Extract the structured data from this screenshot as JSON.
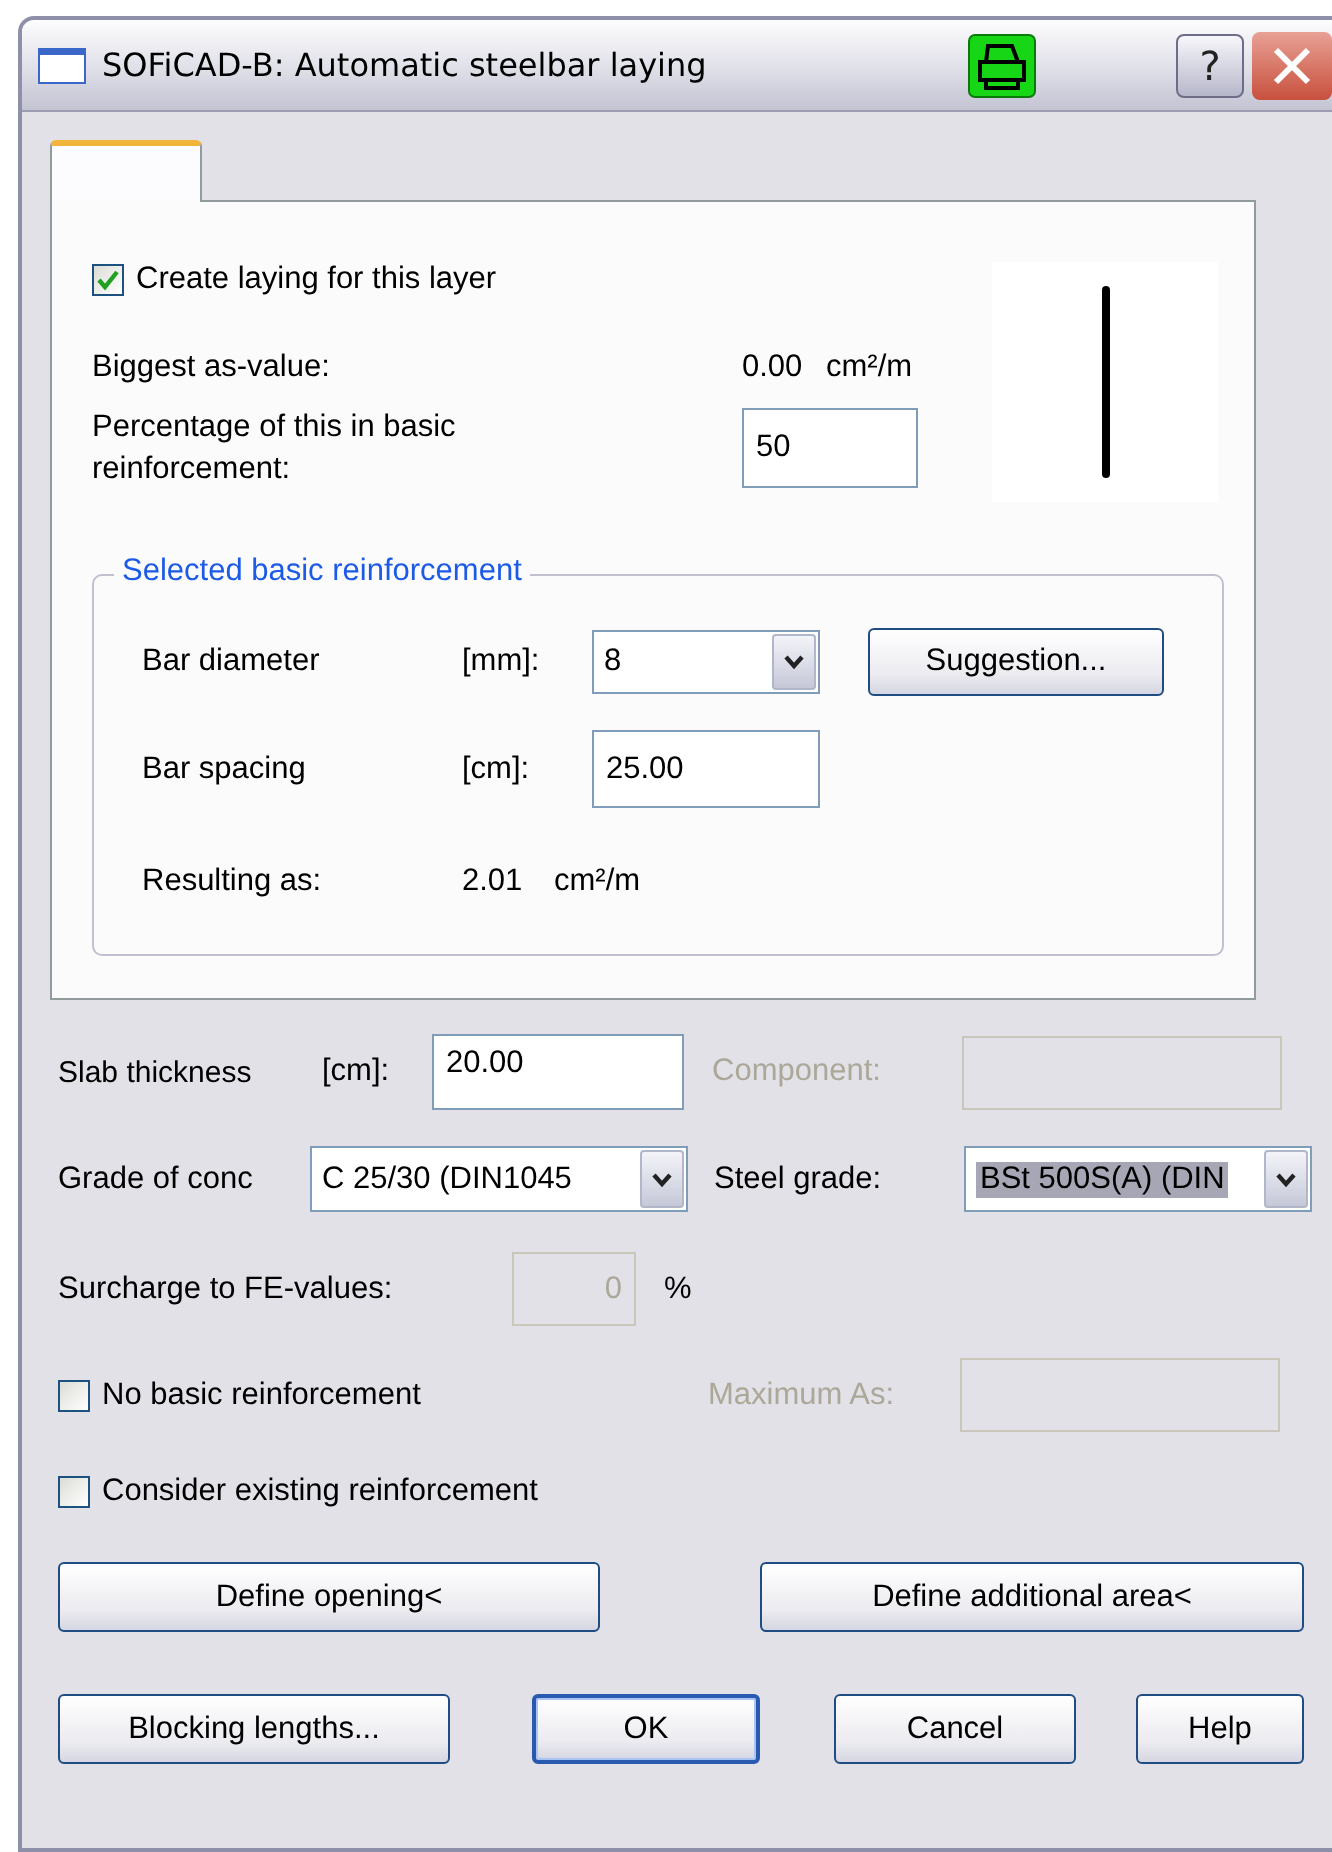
{
  "window": {
    "title": "SOFiCAD-B: Automatic steelbar laying",
    "help_button": "?"
  },
  "tabs": [
    {
      "selected": true
    }
  ],
  "layer_panel": {
    "create_laying": {
      "label": "Create laying for this layer",
      "checked": true
    },
    "biggest": {
      "label": "Biggest as-value:",
      "value": "0.00",
      "unit": "cm²/m"
    },
    "percentage": {
      "label": "Percentage of this in basic reinforcement:",
      "value": "50"
    },
    "basic_reinforcement": {
      "title": "Selected basic reinforcement",
      "bar_diameter": {
        "label": "Bar diameter",
        "unit": "[mm]:",
        "value": "8"
      },
      "suggestion_button": "Suggestion...",
      "bar_spacing": {
        "label": "Bar spacing",
        "unit": "[cm]:",
        "value": "25.00"
      },
      "resulting": {
        "label": "Resulting as:",
        "value": "2.01",
        "unit": "cm²/m"
      }
    }
  },
  "slab_thickness": {
    "label": "Slab thickness",
    "unit": "[cm]:",
    "value": "20.00"
  },
  "component": {
    "label": "Component:",
    "disabled": true
  },
  "grade_of_concrete": {
    "label": "Grade of conc",
    "value": "C 25/30 (DIN1045"
  },
  "steel_grade": {
    "label": "Steel grade:",
    "value": "BSt 500S(A) (DIN",
    "selected": true
  },
  "surcharge": {
    "label": "Surcharge to FE-values:",
    "value": "0",
    "unit": "%",
    "disabled": true
  },
  "no_basic_reinforcement": {
    "label": "No basic reinforcement",
    "checked": false
  },
  "maximum_as": {
    "label": "Maximum As:",
    "disabled": true
  },
  "consider_existing": {
    "label": "Consider existing reinforcement",
    "checked": false
  },
  "buttons_row1": [
    "Define opening<",
    "Define additional area<"
  ],
  "buttons_row2": [
    {
      "label": "Blocking lengths...",
      "default": false
    },
    {
      "label": "OK",
      "default": true
    },
    {
      "label": "Cancel",
      "default": false
    },
    {
      "label": "Help",
      "default": false
    }
  ]
}
